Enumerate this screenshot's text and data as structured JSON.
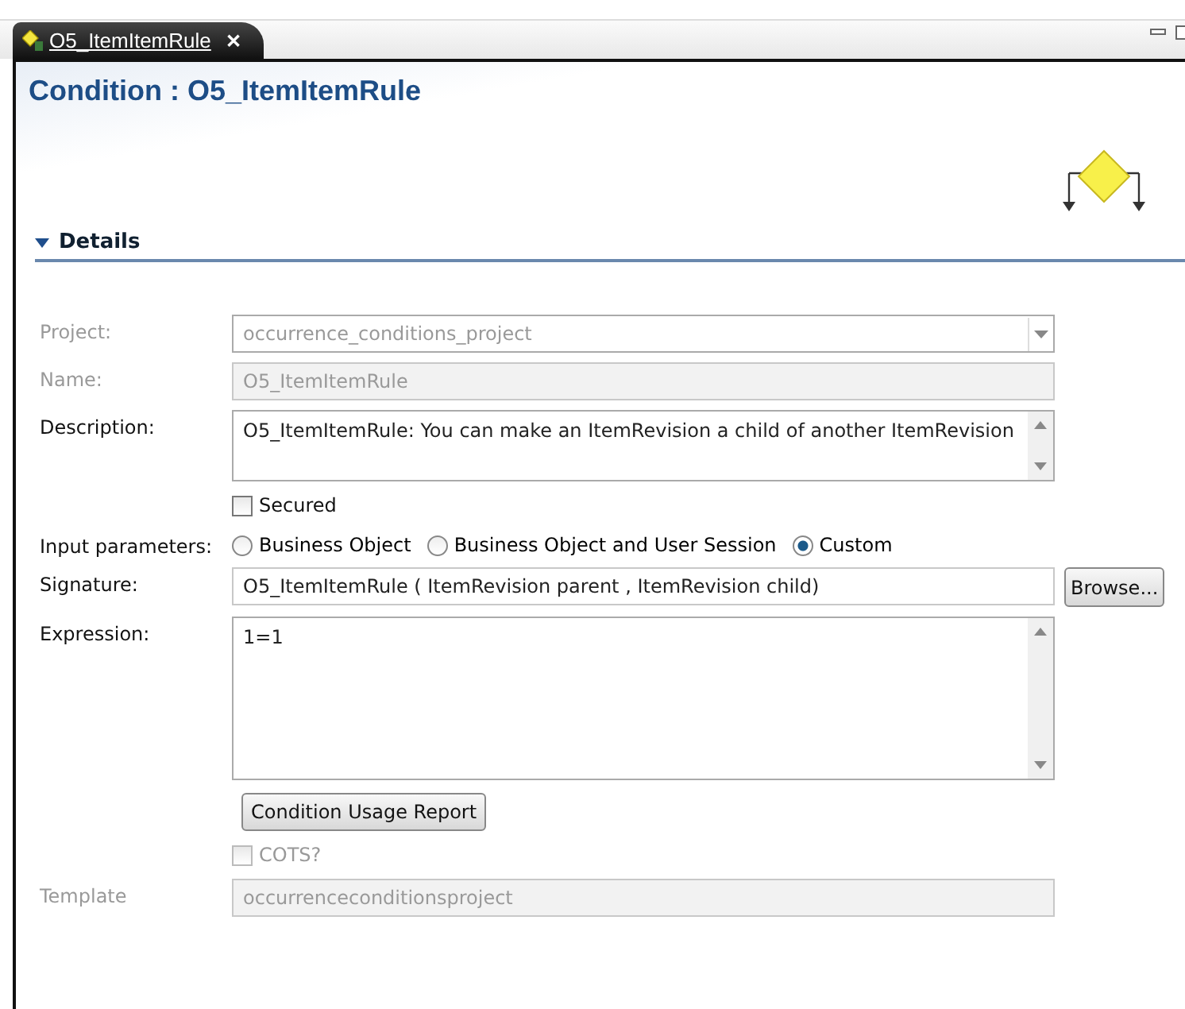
{
  "tab": {
    "label": "O5_ItemItemRule",
    "close": "✕",
    "selected": true
  },
  "title": "Condition : O5_ItemItemRule",
  "section": {
    "label": "Details",
    "expanded": true
  },
  "rows": [
    {
      "kind": "combo",
      "label": "Project:",
      "value": "occurrence_conditions_project",
      "disabled": true
    },
    {
      "kind": "text",
      "label": "Name:",
      "value": "O5_ItemItemRule",
      "disabled": true
    },
    {
      "kind": "textarea",
      "label": "Description:",
      "value": "O5_ItemItemRule: You can make an ItemRevision a child of another ItemRevision",
      "disabled": false
    },
    {
      "kind": "checkbox",
      "label": "Secured",
      "checked": false,
      "disabled": false
    },
    {
      "kind": "radios",
      "label": "Input parameters:",
      "options": [
        {
          "label": "Business Object",
          "selected": false
        },
        {
          "label": "Business Object and User Session",
          "selected": false
        },
        {
          "label": "Custom",
          "selected": true
        }
      ]
    },
    {
      "kind": "text_button",
      "label": "Signature:",
      "value": "O5_ItemItemRule ( ItemRevision parent , ItemRevision child)",
      "button": "Browse...",
      "disabled": false
    },
    {
      "kind": "editor",
      "label": "Expression:",
      "value": "1=1",
      "disabled": false
    },
    {
      "kind": "button",
      "label": "Condition Usage Report"
    },
    {
      "kind": "checkbox",
      "label": "COTS?",
      "checked": false,
      "disabled": true
    },
    {
      "kind": "text",
      "label": "Template",
      "value": "occurrenceconditionsproject",
      "disabled": true
    }
  ]
}
